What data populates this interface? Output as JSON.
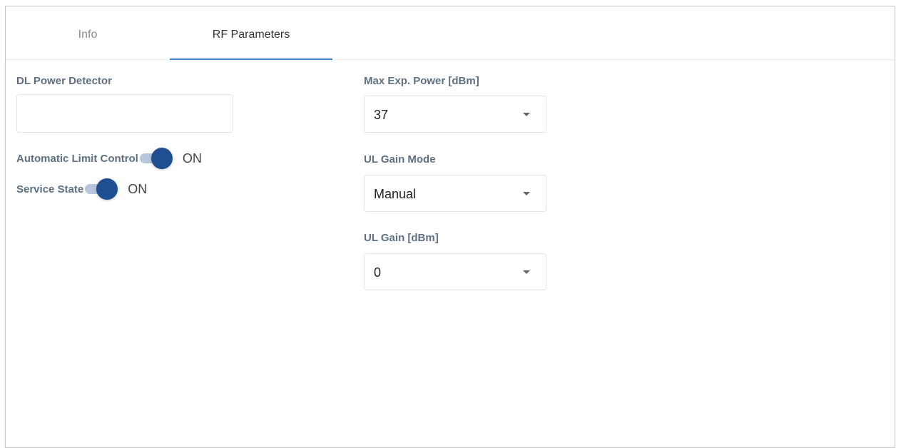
{
  "tabs": [
    {
      "label": "Info",
      "active": false
    },
    {
      "label": "RF Parameters",
      "active": true
    }
  ],
  "left": {
    "dl_power_detector": {
      "label": "DL Power Detector",
      "value": ""
    },
    "automatic_limit_control": {
      "label": "Automatic Limit Control",
      "state": "ON"
    },
    "service_state": {
      "label": "Service State",
      "state": "ON"
    }
  },
  "right": {
    "max_exp_power": {
      "label": "Max Exp. Power [dBm]",
      "value": "37"
    },
    "ul_gain_mode": {
      "label": "UL Gain Mode",
      "value": "Manual"
    },
    "ul_gain": {
      "label": "UL Gain [dBm]",
      "value": "0"
    }
  },
  "colors": {
    "accent": "#3d84c6",
    "switch_knob": "#1f4f91",
    "switch_track": "#b6c6dd",
    "label": "#5f6f82"
  },
  "icons": {
    "select_caret": "caret-down-icon"
  }
}
